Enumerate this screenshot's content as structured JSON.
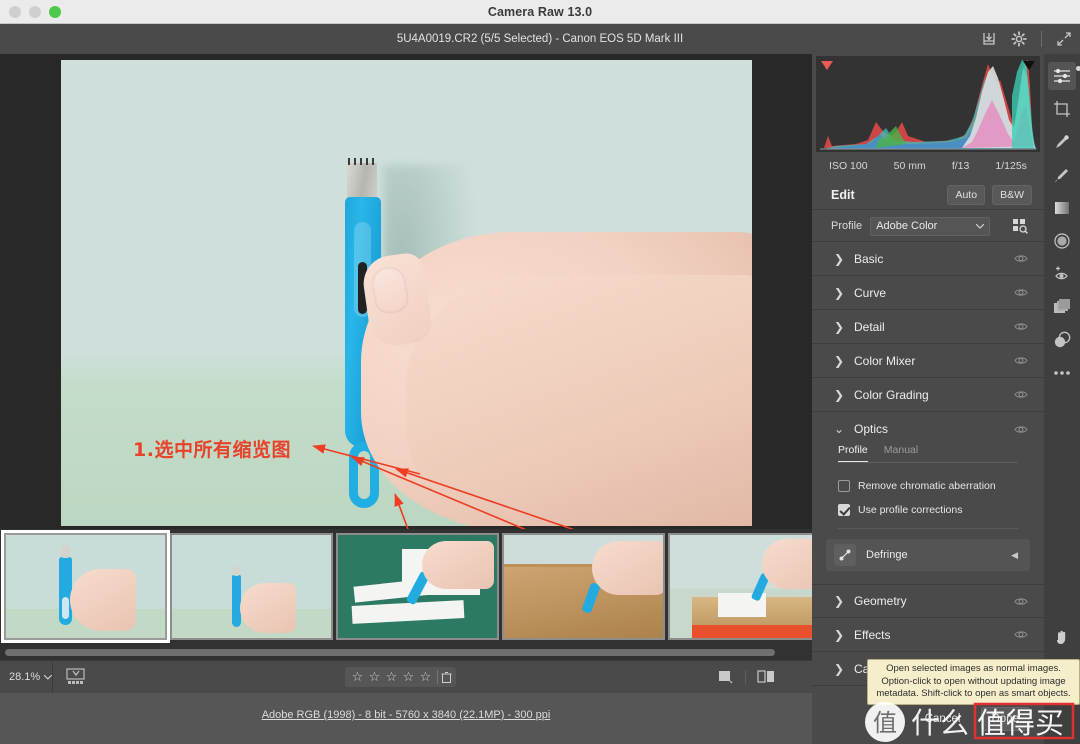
{
  "window": {
    "title": "Camera Raw 13.0",
    "file_title": "5U4A0019.CR2 (5/5 Selected)  -  Canon EOS 5D Mark III",
    "traffic_lights": [
      "close-button",
      "minimize-button",
      "zoom-button"
    ],
    "header_icons": [
      "save-image-icon",
      "preferences-gear-icon",
      "fullscreen-icon"
    ]
  },
  "annotation": {
    "text": "1.选中所有缩览图",
    "color": "#e8432a"
  },
  "histogram": {
    "shadow_clip_label": "shadow-clipping-warning",
    "highlight_clip_label": "highlight-clipping-warning"
  },
  "exif": {
    "iso": "ISO 100",
    "focal": "50 mm",
    "aperture": "f/13",
    "shutter": "1/125s"
  },
  "edit": {
    "title": "Edit",
    "auto_label": "Auto",
    "bw_label": "B&W"
  },
  "profile": {
    "label": "Profile",
    "value": "Adobe Color",
    "browse_icon": "profile-browser-icon"
  },
  "sections": [
    {
      "name": "Basic",
      "expanded": false
    },
    {
      "name": "Curve",
      "expanded": false
    },
    {
      "name": "Detail",
      "expanded": false
    },
    {
      "name": "Color Mixer",
      "expanded": false
    },
    {
      "name": "Color Grading",
      "expanded": false
    },
    {
      "name": "Optics",
      "expanded": true
    },
    {
      "name": "Geometry",
      "expanded": false
    },
    {
      "name": "Effects",
      "expanded": false
    },
    {
      "name": "Calibration",
      "expanded": false
    }
  ],
  "optics": {
    "tabs": [
      {
        "label": "Profile",
        "active": true
      },
      {
        "label": "Manual",
        "active": false
      }
    ],
    "remove_ca": {
      "label": "Remove chromatic aberration",
      "checked": false
    },
    "use_profile": {
      "label": "Use profile corrections",
      "checked": true
    },
    "defringe": {
      "label": "Defringe"
    }
  },
  "bottom_toolbar": {
    "zoom_level": "28.1%",
    "zoom_caret": "chevron-down-icon",
    "filmstrip_toggle_icon": "filmstrip-view-icon",
    "stars": 5,
    "star_glyph": "☆",
    "reject_icon": "reject-trash-icon",
    "single_view_icon": "single-view-icon",
    "compare_view_icon": "compare-view-icon"
  },
  "status": {
    "text": "Adobe RGB (1998) - 8 bit - 5760 x 3840 (22.1MP) - 300 ppi"
  },
  "footer": {
    "cancel_label": "Cancel",
    "done_label": "Done"
  },
  "tooltip": {
    "text": "Open selected images as normal images. Option-click to open without updating image metadata.  Shift-click to open as smart objects."
  },
  "rail_tools": [
    {
      "name": "edit-sliders-tool",
      "active": true
    },
    {
      "name": "crop-tool",
      "active": false
    },
    {
      "name": "spot-removal-tool",
      "active": false
    },
    {
      "name": "masking-brush-tool",
      "active": false
    },
    {
      "name": "graduated-filter-tool",
      "active": false
    },
    {
      "name": "radial-filter-tool",
      "active": false
    },
    {
      "name": "red-eye-tool",
      "active": false
    },
    {
      "name": "presets-tool",
      "active": false
    },
    {
      "name": "snapshots-tool",
      "active": false
    },
    {
      "name": "more-options-tool",
      "active": false
    }
  ],
  "rail_bottom_tools": [
    {
      "name": "hand-tool",
      "active": false
    },
    {
      "name": "white-balance-tool",
      "active": false
    }
  ],
  "filmstrip": {
    "thumbnails": [
      {
        "id": "thumb-1",
        "selected": true,
        "scene": "knife-held-vertical"
      },
      {
        "id": "thumb-2",
        "selected": false,
        "scene": "knife-held-small"
      },
      {
        "id": "thumb-3",
        "selected": false,
        "scene": "cutting-paper-on-mat"
      },
      {
        "id": "thumb-4",
        "selected": false,
        "scene": "cutting-cardboard-box"
      },
      {
        "id": "thumb-5",
        "selected": false,
        "scene": "cutting-parcel-label"
      }
    ]
  },
  "watermark": {
    "text": "值什么值得买"
  }
}
